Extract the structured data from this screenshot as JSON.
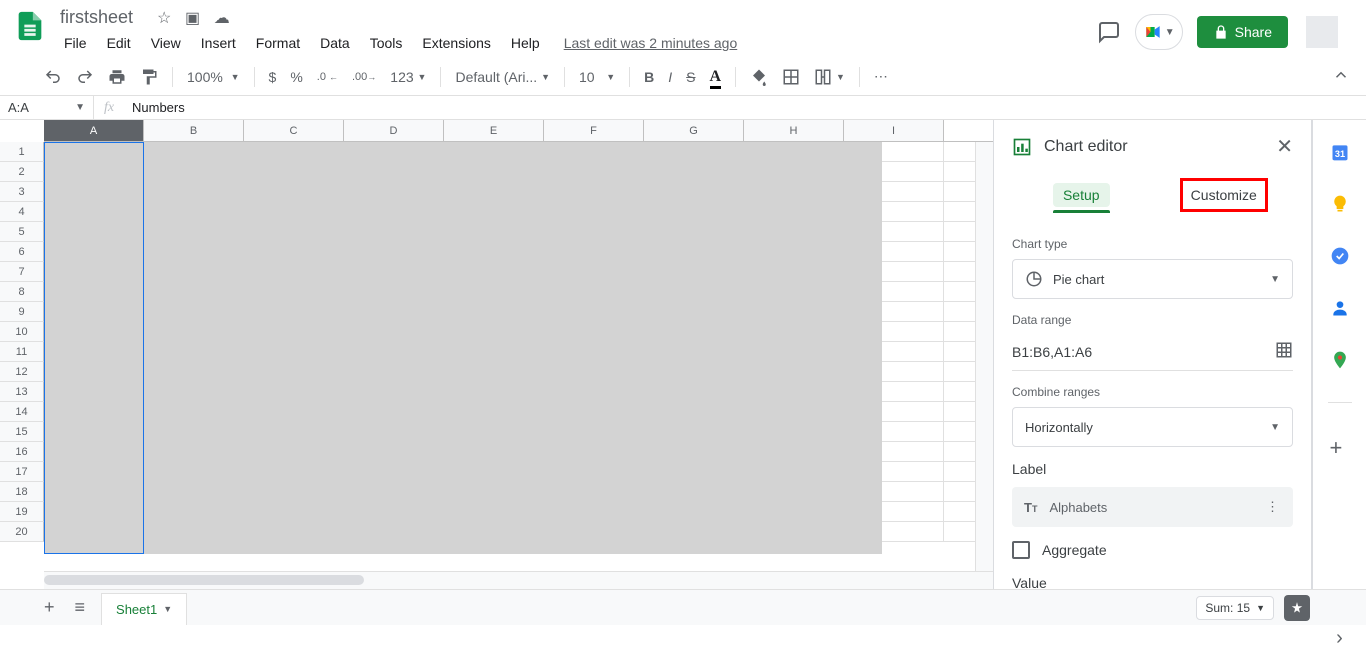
{
  "doc": {
    "title": "firstsheet"
  },
  "menu": {
    "file": "File",
    "edit": "Edit",
    "view": "View",
    "insert": "Insert",
    "format": "Format",
    "data": "Data",
    "tools": "Tools",
    "extensions": "Extensions",
    "help": "Help",
    "last_edit": "Last edit was 2 minutes ago"
  },
  "header": {
    "share": "Share"
  },
  "toolbar": {
    "zoom": "100%",
    "currency": "$",
    "percent": "%",
    "dec_dec": ".0",
    "inc_dec": ".00",
    "more_formats": "123",
    "font": "Default (Ari...",
    "font_size": "10"
  },
  "fx": {
    "name_box": "A:A",
    "formula": "Numbers"
  },
  "columns": [
    "A",
    "B",
    "C",
    "D",
    "E",
    "F",
    "G",
    "H",
    "I"
  ],
  "rows": [
    "1",
    "2",
    "3",
    "4",
    "5",
    "6",
    "7",
    "8",
    "9",
    "10",
    "11",
    "12",
    "13",
    "14",
    "15",
    "16",
    "17",
    "18",
    "19",
    "20"
  ],
  "panel": {
    "title": "Chart editor",
    "tab_setup": "Setup",
    "tab_customize": "Customize",
    "chart_type_label": "Chart type",
    "chart_type_value": "Pie chart",
    "data_range_label": "Data range",
    "data_range_value": "B1:B6,A1:A6",
    "combine_label": "Combine ranges",
    "combine_value": "Horizontally",
    "label_label": "Label",
    "label_value": "Alphabets",
    "aggregate": "Aggregate",
    "value_label": "Value"
  },
  "sheetbar": {
    "tab": "Sheet1",
    "sum": "Sum: 15"
  }
}
